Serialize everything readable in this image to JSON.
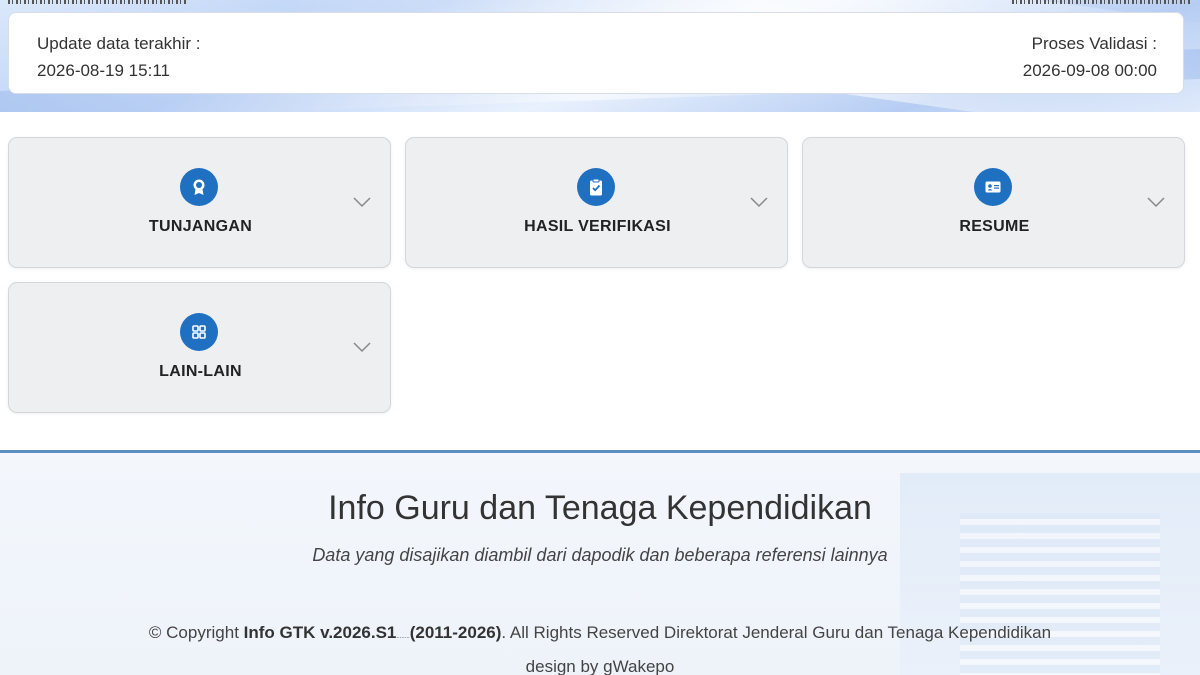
{
  "header": {
    "update_label": "Update data terakhir :",
    "update_value": "2026-08-19 15:11",
    "validation_label": "Proses Validasi :",
    "validation_value": "2026-09-08 00:00"
  },
  "tiles": [
    {
      "label": "TUNJANGAN",
      "icon": "award-icon"
    },
    {
      "label": "HASIL VERIFIKASI",
      "icon": "clipboard-check-icon"
    },
    {
      "label": "RESUME",
      "icon": "id-card-icon"
    },
    {
      "label": "LAIN-LAIN",
      "icon": "grid-icon"
    }
  ],
  "footer": {
    "title": "Info Guru dan Tenaga Kependidikan",
    "subtitle": "Data yang disajikan diambil dari dapodik dan beberapa referensi lainnya",
    "copyright_prefix": "© Copyright ",
    "copyright_app": "Info GTK v.2026.S1",
    "copyright_build": "........",
    "copyright_years": "(2011-2026)",
    "copyright_suffix": ". All Rights Reserved Direktorat Jenderal Guru dan Tenaga Kependidikan",
    "design": "design by gWakepo"
  },
  "colors": {
    "icon_bg": "#1f70c1",
    "footer_border": "#5a8ec2",
    "tile_bg": "#eeeff1"
  }
}
